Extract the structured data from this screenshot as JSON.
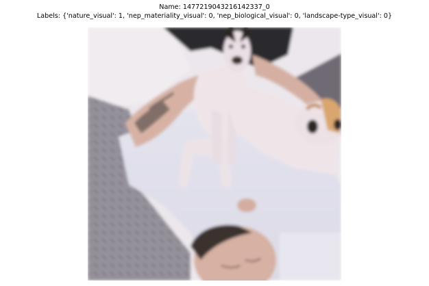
{
  "figure": {
    "name_line": "Name: 1477219043216142337_0",
    "labels_line": "Labels: {'nature_visual': 1, 'nep_materiality_visual': 0, 'nep_biological_visual': 0, 'landscape-type_visual': 0}"
  },
  "colors": {
    "background": "#ffffff",
    "text": "#000000",
    "bedding": "#e9e6ec",
    "dog_fur": "#efe6ea",
    "dog_dark": "#3a302c",
    "dog_tan": "#d9a66f",
    "skin": "#d8b3a6",
    "pillow_gray": "#8c8791",
    "dark_clothing": "#2b2a2d",
    "tattoo": "#6b5d58"
  }
}
